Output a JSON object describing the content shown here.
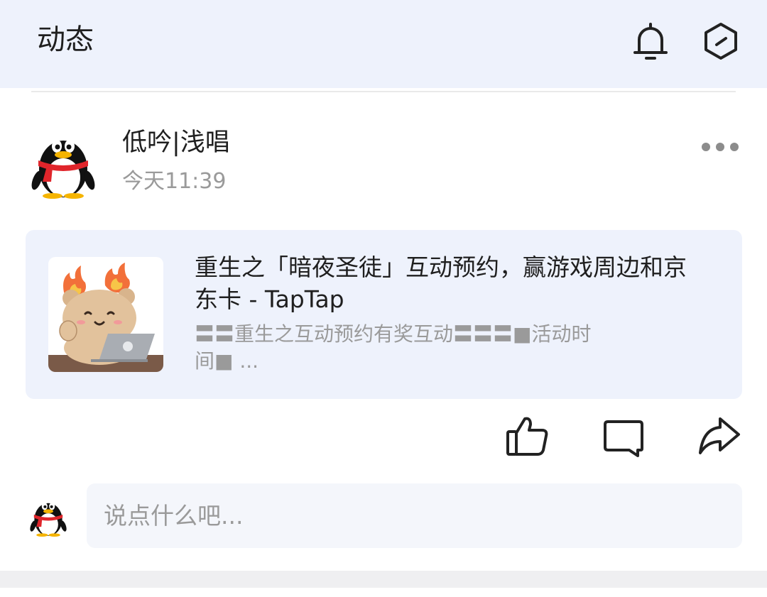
{
  "header": {
    "title": "动态",
    "icons": [
      "bell-icon",
      "hexagon-minus-icon"
    ]
  },
  "post": {
    "user": {
      "name": "低吟|浅唱",
      "time": "今天11:39",
      "avatar": "penguin-avatar"
    },
    "more_icon": "more-horizontal-icon",
    "card": {
      "title": "重生之「暗夜圣徒」互动预约，赢游戏周边和京东卡 - TapTap",
      "description": "〓〓重生之互动预约有奖互动〓〓〓■活动时间■ ...",
      "thumbnail": "bear-laptop-fire-sticker"
    },
    "actions": {
      "like_icon": "thumbs-up-icon",
      "comment_icon": "comment-bubble-icon",
      "share_icon": "share-arrow-icon"
    }
  },
  "comment_box": {
    "placeholder": "说点什么吧..."
  },
  "colors": {
    "header_bg": "#eef2fc",
    "card_bg": "#eef2fc",
    "input_bg": "#f4f6fb",
    "text_primary": "#1f1f1f",
    "text_secondary": "#9a9a9a"
  }
}
